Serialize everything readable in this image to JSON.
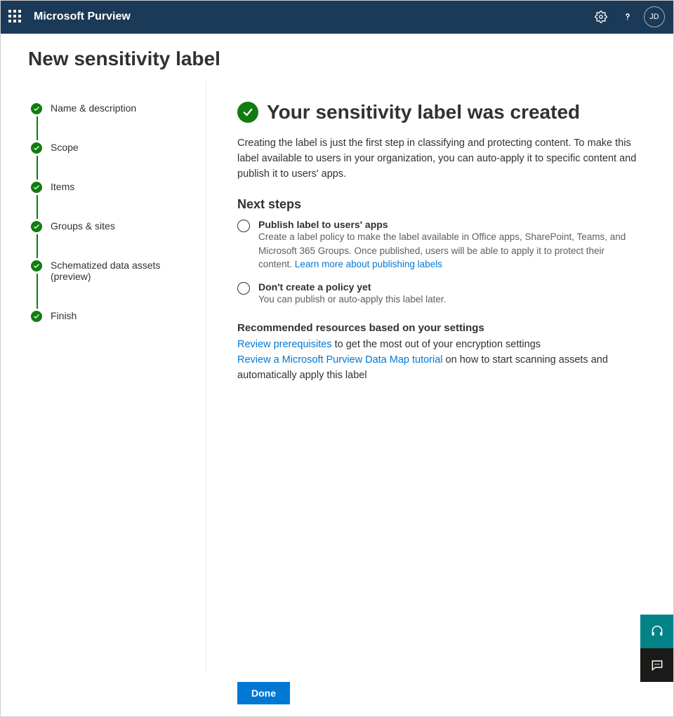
{
  "header": {
    "brand": "Microsoft Purview",
    "avatar_initials": "JD"
  },
  "page": {
    "title": "New sensitivity label"
  },
  "sidebar": {
    "steps": [
      {
        "label": "Name & description"
      },
      {
        "label": "Scope"
      },
      {
        "label": "Items"
      },
      {
        "label": "Groups & sites"
      },
      {
        "label": "Schematized data assets (preview)"
      },
      {
        "label": "Finish"
      }
    ]
  },
  "main": {
    "success_title": "Your sensitivity label was created",
    "intro": "Creating the label is just the first step in classifying and protecting content. To make this label available to users in your organization, you can auto-apply it to specific content and publish it to users' apps.",
    "next_steps_heading": "Next steps",
    "options": [
      {
        "title": "Publish label to users' apps",
        "desc_prefix": "Create a label policy to make the label available in Office apps, SharePoint, Teams, and Microsoft 365 Groups. Once published, users will be able to apply it to protect their content. ",
        "link": "Learn more about publishing labels"
      },
      {
        "title": "Don't create a policy yet",
        "desc_prefix": "You can publish or auto-apply this label later.",
        "link": ""
      }
    ],
    "rec_heading": "Recommended resources based on your settings",
    "rec1_link": "Review prerequisites",
    "rec1_tail": " to get the most out of your encryption settings",
    "rec2_link": "Review a Microsoft Purview Data Map tutorial",
    "rec2_tail": " on how to start scanning assets and automatically apply this label"
  },
  "footer": {
    "done_label": "Done"
  }
}
